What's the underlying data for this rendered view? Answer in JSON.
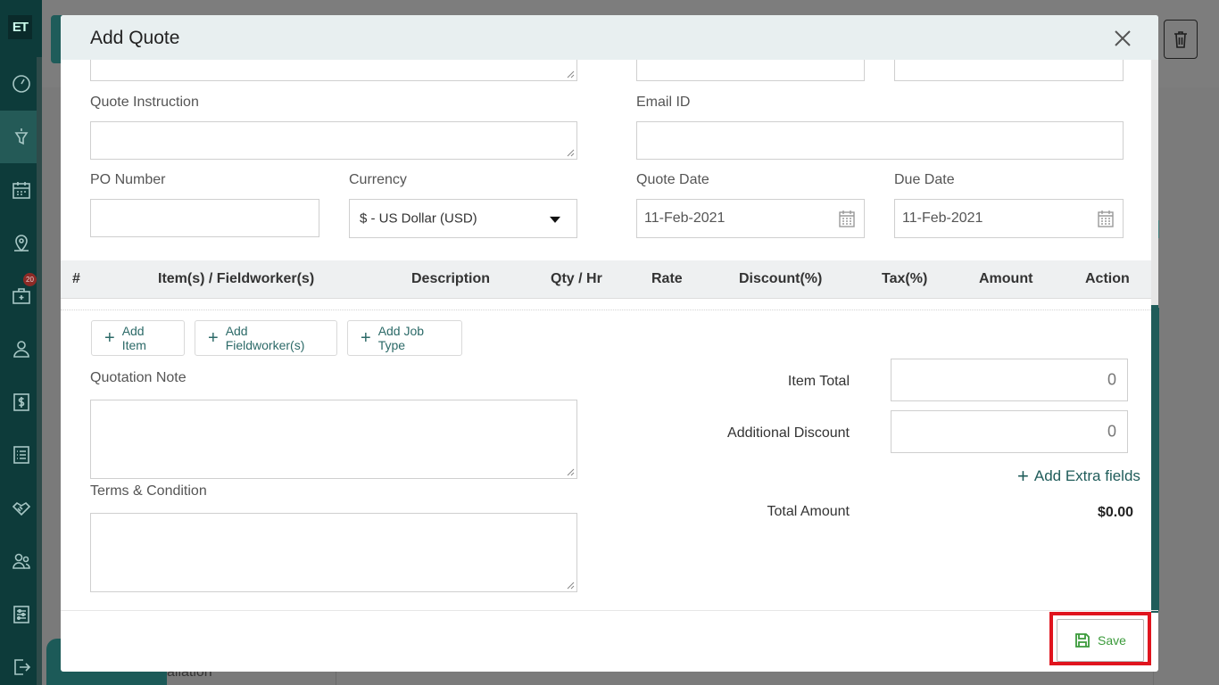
{
  "app": {
    "logo_text": "ET",
    "sidebar": {
      "items": [
        {
          "icon": "dashboard-icon"
        },
        {
          "icon": "funnel-icon",
          "active": true
        },
        {
          "icon": "calendar-icon"
        },
        {
          "icon": "map-pin-icon"
        },
        {
          "icon": "jobs-icon",
          "badge": "20"
        },
        {
          "icon": "user-icon"
        },
        {
          "icon": "dollar-icon"
        },
        {
          "icon": "list-icon"
        },
        {
          "icon": "handshake-icon"
        },
        {
          "icon": "users-icon"
        },
        {
          "icon": "settings-sliders-icon"
        },
        {
          "icon": "logout-icon"
        }
      ]
    },
    "background_text": "allation"
  },
  "modal": {
    "title": "Add Quote",
    "fields": {
      "quote_instruction_label": "Quote Instruction",
      "email_label": "Email ID",
      "po_number_label": "PO Number",
      "currency_label": "Currency",
      "currency_value": "$ - US Dollar (USD)",
      "quote_date_label": "Quote Date",
      "quote_date_value": "11-Feb-2021",
      "due_date_label": "Due Date",
      "due_date_value": "11-Feb-2021"
    },
    "table": {
      "headers": [
        "#",
        "Item(s) / Fieldworker(s)",
        "Description",
        "Qty / Hr",
        "Rate",
        "Discount(%)",
        "Tax(%)",
        "Amount",
        "Action"
      ]
    },
    "actions": {
      "add_item": "Add Item",
      "add_fieldworker": "Add Fieldworker(s)",
      "add_job_type": "Add Job Type"
    },
    "notes": {
      "quotation_note_label": "Quotation Note",
      "terms_label": "Terms & Condition"
    },
    "summary": {
      "item_total_label": "Item Total",
      "item_total_value": "0",
      "additional_discount_label": "Additional Discount",
      "additional_discount_value": "0",
      "add_extra_fields": "Add Extra fields",
      "total_amount_label": "Total Amount",
      "total_amount_value": "$0.00"
    },
    "footer": {
      "save_label": "Save"
    }
  },
  "colors": {
    "brand_teal": "#1f5c5a",
    "save_green": "#3a9a3a",
    "highlight_red": "#e0141e"
  }
}
